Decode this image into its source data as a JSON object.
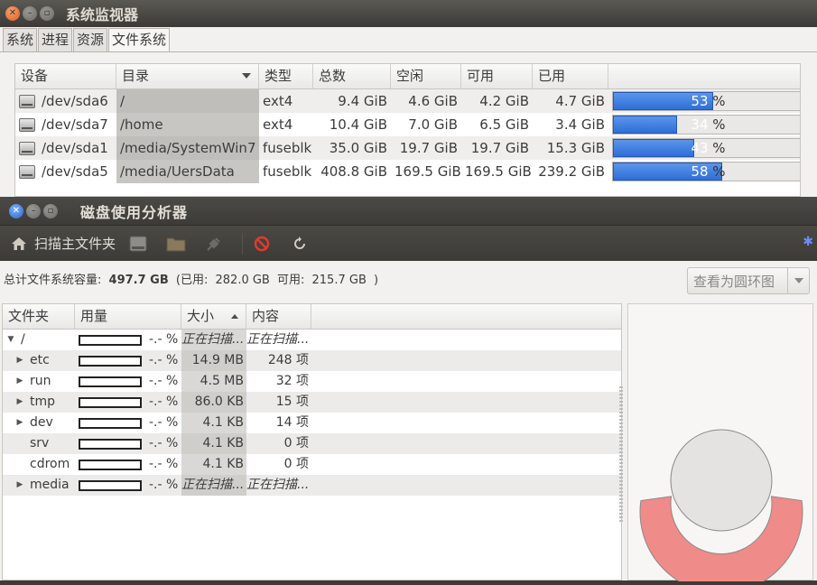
{
  "system_monitor": {
    "title": "系统监视器",
    "tabs": [
      "系统",
      "进程",
      "资源",
      "文件系统"
    ],
    "columns": [
      "设备",
      "目录",
      "类型",
      "总数",
      "空闲",
      "可用",
      "已用"
    ],
    "rows": [
      {
        "device": "/dev/sda6",
        "dir": "/",
        "type": "ext4",
        "total": "9.4 GiB",
        "free": "4.6 GiB",
        "avail": "4.2 GiB",
        "used": "4.7 GiB",
        "pct": 53
      },
      {
        "device": "/dev/sda7",
        "dir": "/home",
        "type": "ext4",
        "total": "10.4 GiB",
        "free": "7.0 GiB",
        "avail": "6.5 GiB",
        "used": "3.4 GiB",
        "pct": 34
      },
      {
        "device": "/dev/sda1",
        "dir": "/media/SystemWin7",
        "type": "fuseblk",
        "total": "35.0 GiB",
        "free": "19.7 GiB",
        "avail": "19.7 GiB",
        "used": "15.3 GiB",
        "pct": 43
      },
      {
        "device": "/dev/sda5",
        "dir": "/media/UersData",
        "type": "fuseblk",
        "total": "408.8 GiB",
        "free": "169.5 GiB",
        "avail": "169.5 GiB",
        "used": "239.2 GiB",
        "pct": 58
      }
    ],
    "pct_suffix": "%"
  },
  "baobab": {
    "title": "磁盘使用分析器",
    "toolbar": {
      "scan_home": "扫描主文件夹"
    },
    "summary": {
      "label": "总计文件系统容量:",
      "capacity": "497.7 GB",
      "used_label": "(已用:",
      "used": "282.0 GB",
      "avail_label": "可用:",
      "avail": "215.7 GB",
      "close": ")"
    },
    "view_button": "查看为圆环图",
    "columns": [
      "文件夹",
      "用量",
      "大小",
      "内容"
    ],
    "rows": [
      {
        "name": "/",
        "usage": "-.- %",
        "size": "正在扫描...",
        "items": "正在扫描...",
        "expander": "open",
        "scanning": true
      },
      {
        "name": "etc",
        "usage": "-.- %",
        "size": "14.9 MB",
        "items": "248 项",
        "expander": "closed"
      },
      {
        "name": "run",
        "usage": "-.- %",
        "size": "4.5 MB",
        "items": "32 项",
        "expander": "closed"
      },
      {
        "name": "tmp",
        "usage": "-.- %",
        "size": "86.0 KB",
        "items": "15 项",
        "expander": "closed"
      },
      {
        "name": "dev",
        "usage": "-.- %",
        "size": "4.1 KB",
        "items": "14 项",
        "expander": "closed"
      },
      {
        "name": "srv",
        "usage": "-.- %",
        "size": "4.1 KB",
        "items": "0 项",
        "expander": "none"
      },
      {
        "name": "cdrom",
        "usage": "-.- %",
        "size": "4.1 KB",
        "items": "0 项",
        "expander": "none"
      },
      {
        "name": "media",
        "usage": "-.- %",
        "size": "正在扫描...",
        "items": "正在扫描...",
        "expander": "closed",
        "scanning": true
      }
    ],
    "ring_colors": {
      "ring": "#ef8b88",
      "center": "#e4e3e1"
    }
  }
}
